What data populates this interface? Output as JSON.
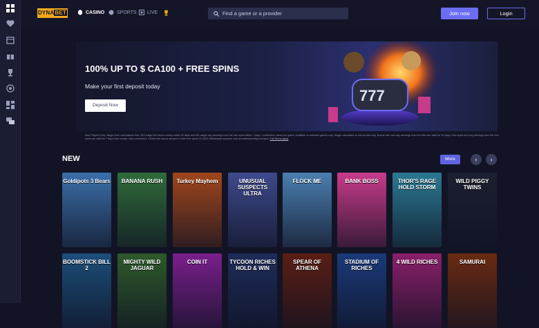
{
  "sidebar": {
    "icons": [
      "grid-icon",
      "heart-icon",
      "calendar-icon",
      "gift-icon",
      "trophy-icon",
      "target-icon",
      "dashboard-icon",
      "chat-icon"
    ]
  },
  "header": {
    "logo": {
      "left": "DYNA",
      "right": "BET"
    },
    "nav": [
      {
        "label": "CASINO",
        "icon": "cards-icon"
      },
      {
        "label": "SPORTS",
        "icon": "ball-icon"
      },
      {
        "label": "LIVE",
        "icon": "live-icon"
      }
    ],
    "search_placeholder": "Find a game or a provider",
    "join_label": "Join now",
    "login_label": "Login"
  },
  "banner": {
    "title": "100% UP TO $ CA100 + FREE SPINS",
    "subtitle": "Make your first deposit today",
    "button": "Deposit Now"
  },
  "terms": {
    "text": "New Players Only. Wager from real balance first. 50X wager the bonus money within 30 days and 50x wager any winnings from the free spins within 7 days. Contribution varies per game. Available on selected games only. Wager calculated on bonus bets only. Bonus offer and any winnings from the offer are valid for 30 days / free spins and any winnings from the free spins are valid for 7 days from receipt. Max conversion: 3 times the bonus amount or from free spins: $ CA20. Withdrawal requests void all active/pending bonuses.",
    "link": "Full Terms apply"
  },
  "section": {
    "title": "NEW",
    "more": "More",
    "prev": "‹",
    "next": "›"
  },
  "games_row1": [
    {
      "name": "Goldipots 3 Bears",
      "color": "#3a6fa8"
    },
    {
      "name": "BANANA RUSH",
      "color": "#2f6b3a"
    },
    {
      "name": "Turkey Mayhem",
      "color": "#a0461c"
    },
    {
      "name": "UNUSUAL SUSPECTS ULTRA",
      "color": "#3e4a8c"
    },
    {
      "name": "FLOCK ME",
      "color": "#4a7fb0"
    },
    {
      "name": "BANK BOSS",
      "color": "#c83a8a"
    },
    {
      "name": "THOR'S RAGE HOLD STORM",
      "color": "#2a7a92"
    },
    {
      "name": "WILD PIGGY TWINS",
      "color": "#1c2030"
    }
  ],
  "games_row2": [
    {
      "name": "BOOMSTICK BILL 2",
      "color": "#1c4e7a"
    },
    {
      "name": "MIGHTY WILD JAGUAR",
      "color": "#2d5a2a"
    },
    {
      "name": "COIN IT",
      "color": "#7a1f8c"
    },
    {
      "name": "TYCOON RICHES HOLD & WIN",
      "color": "#1e2c5a"
    },
    {
      "name": "SPEAR OF ATHENA",
      "color": "#5a1e14"
    },
    {
      "name": "STADIUM OF RICHES",
      "color": "#1a3a7a"
    },
    {
      "name": "4 WILD RICHES",
      "color": "#8a1f6a"
    },
    {
      "name": "SAMURAI",
      "color": "#6a2a12"
    }
  ]
}
